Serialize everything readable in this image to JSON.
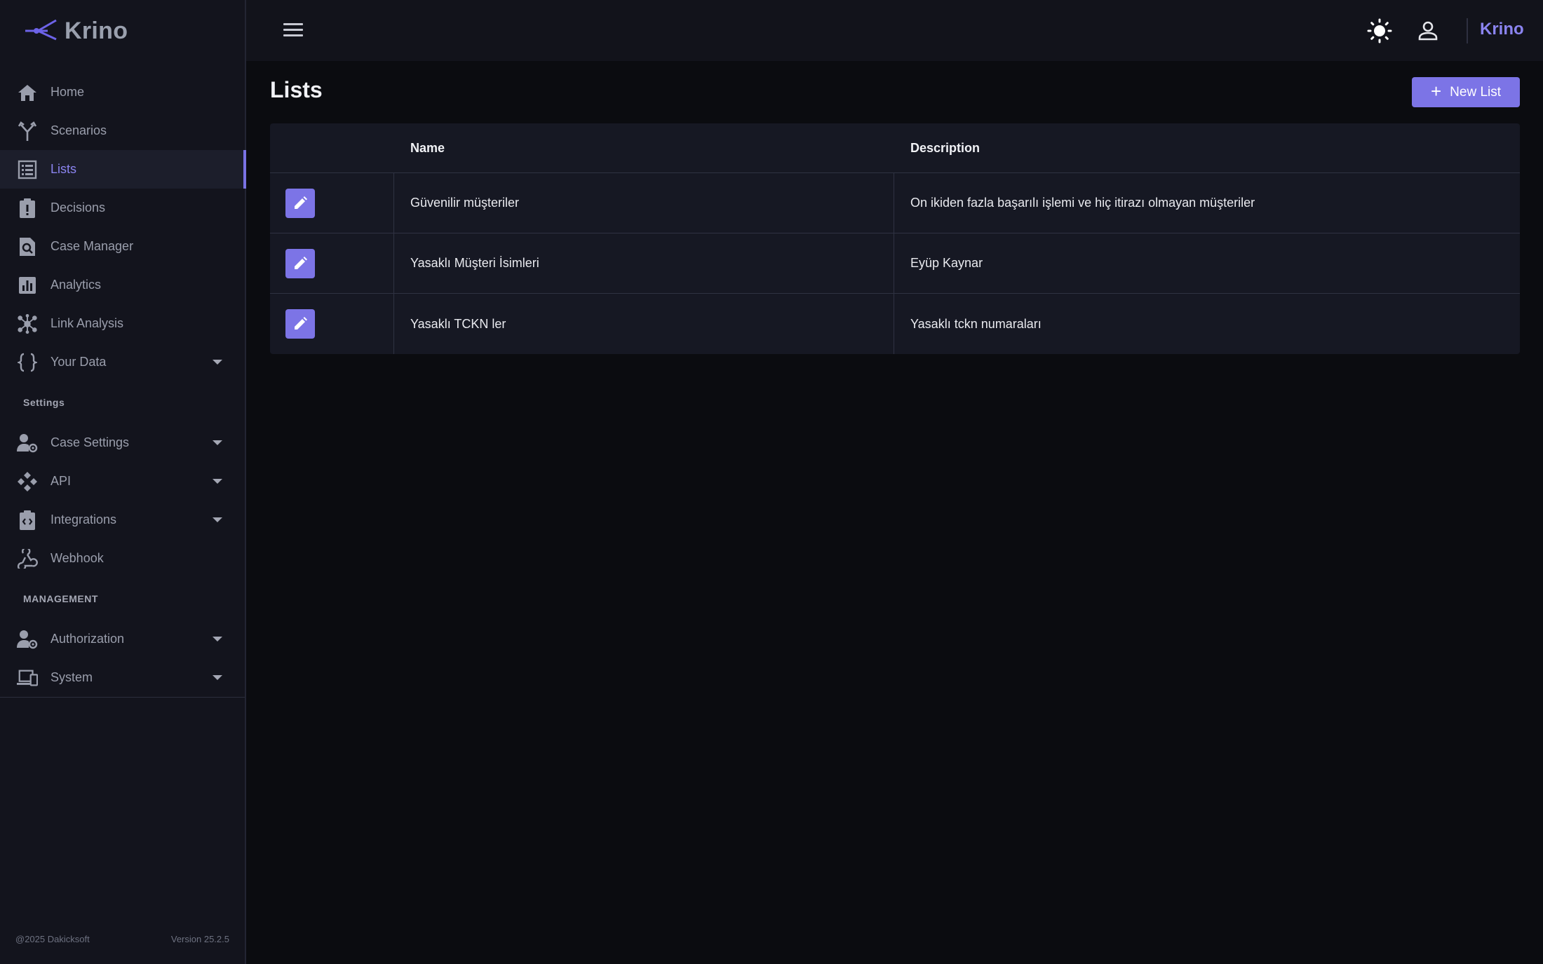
{
  "app": {
    "name": "Krino"
  },
  "sidebar": {
    "items": [
      {
        "label": "Home",
        "icon": "home-icon"
      },
      {
        "label": "Scenarios",
        "icon": "fork-icon"
      },
      {
        "label": "Lists",
        "icon": "list-icon",
        "active": true
      },
      {
        "label": "Decisions",
        "icon": "clipboard-alert-icon"
      },
      {
        "label": "Case Manager",
        "icon": "document-search-icon"
      },
      {
        "label": "Analytics",
        "icon": "chart-icon"
      },
      {
        "label": "Link Analysis",
        "icon": "network-icon"
      },
      {
        "label": "Your Data",
        "icon": "braces-icon",
        "expandable": true
      }
    ],
    "settings_label": "Settings",
    "settings_items": [
      {
        "label": "Case Settings",
        "icon": "user-gear-icon",
        "expandable": true
      },
      {
        "label": "API",
        "icon": "api-icon",
        "expandable": true
      },
      {
        "label": "Integrations",
        "icon": "integration-icon",
        "expandable": true
      },
      {
        "label": "Webhook",
        "icon": "webhook-icon"
      }
    ],
    "management_label": "MANAGEMENT",
    "management_items": [
      {
        "label": "Authorization",
        "icon": "user-gear-icon",
        "expandable": true
      },
      {
        "label": "System",
        "icon": "devices-icon",
        "expandable": true
      }
    ],
    "footer": {
      "copyright": "@2025 Dakicksoft",
      "version": "Version 25.2.5"
    }
  },
  "topbar": {
    "brand": "Krino"
  },
  "main": {
    "title": "Lists",
    "new_button": "New List",
    "table": {
      "headers": [
        "",
        "Name",
        "Description"
      ],
      "rows": [
        {
          "name": "Güvenilir müşteriler",
          "description": "On ikiden fazla başarılı işlemi ve hiç itirazı olmayan müşteriler"
        },
        {
          "name": "Yasaklı Müşteri İsimleri",
          "description": "Eyüp Kaynar"
        },
        {
          "name": "Yasaklı TCKN ler",
          "description": "Yasaklı tckn numaraları"
        }
      ]
    }
  },
  "colors": {
    "accent": "#7c74e6",
    "sidebar_bg": "#13141d",
    "page_bg": "#0b0c10"
  }
}
